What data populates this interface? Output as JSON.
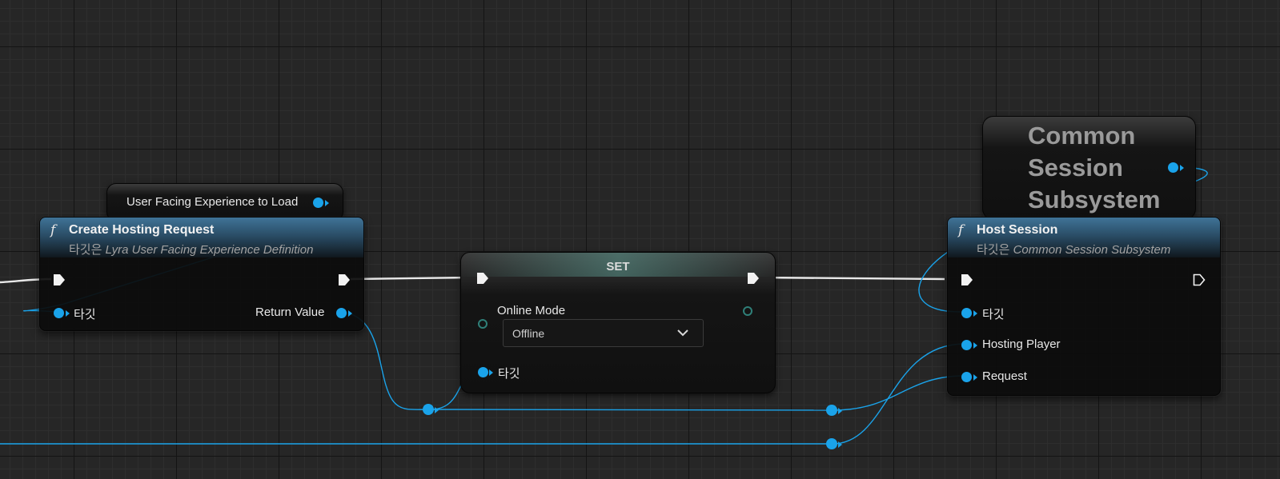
{
  "create_node": {
    "title": "Create Hosting Request",
    "target_prefix": "타깃은",
    "target_class": "Lyra User Facing Experience Definition",
    "pin_target": "타깃",
    "pin_return": "Return Value"
  },
  "var_user_facing": {
    "label": "User Facing Experience to Load"
  },
  "set_node": {
    "title": "SET",
    "field_label": "Online Mode",
    "dropdown_value": "Offline",
    "pin_target": "타깃"
  },
  "var_subsystem": {
    "title_lines": [
      "Common",
      "Session",
      "Subsystem"
    ]
  },
  "host_node": {
    "title": "Host Session",
    "target_prefix": "타깃은",
    "target_class": "Common Session Subsystem",
    "pin_target": "타깃",
    "pin_hosting_player": "Hosting Player",
    "pin_request": "Request"
  },
  "colors": {
    "object_pin": "#1aa3ea",
    "exec_wire": "#e8e8e8",
    "enum_pin": "#2f7f78",
    "function_header": "#3f7397"
  },
  "icons": {
    "function": "function-icon",
    "exec": "exec-pin-icon",
    "dropdown": "chevron-down-icon"
  }
}
